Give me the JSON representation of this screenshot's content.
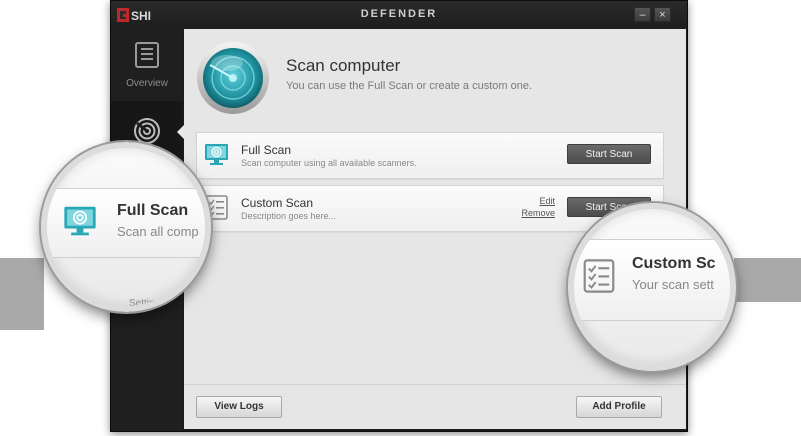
{
  "window": {
    "title": "DEFENDER",
    "brand": "GSHI",
    "controls": {
      "minimize": "–",
      "close": "×"
    }
  },
  "sidebar": {
    "items": [
      {
        "label": "Overview",
        "icon": "overview-icon"
      },
      {
        "label": "",
        "icon": "scan-icon",
        "active": true
      }
    ],
    "partial_label": "Settings"
  },
  "header": {
    "title": "Scan computer",
    "subtitle": "You can use the Full Scan or create a custom one."
  },
  "profiles": [
    {
      "title": "Full Scan",
      "description": "Scan computer using all available scanners.",
      "button": "Start Scan",
      "icon": "monitor-icon"
    },
    {
      "title": "Custom Scan",
      "description": "Description goes here...",
      "button": "Start Scan",
      "icon": "checklist-icon",
      "edit": "Edit",
      "remove": "Remove"
    }
  ],
  "footer": {
    "view_logs": "View Logs",
    "add_profile": "Add Profile"
  },
  "zoom": {
    "left": {
      "title": "Full Scan",
      "desc": "Scan all comp"
    },
    "right": {
      "title": "Custom Sc",
      "desc": "Your scan sett"
    }
  },
  "colors": {
    "accent_teal": "#2aa7b5",
    "sidebar_bg": "#1f1f1f",
    "content_bg": "#e6e6e6"
  }
}
